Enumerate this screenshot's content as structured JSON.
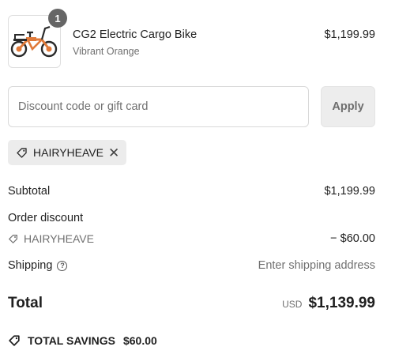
{
  "product": {
    "quantity": "1",
    "name": "CG2 Electric Cargo Bike",
    "variant": "Vibrant Orange",
    "price": "$1,199.99",
    "image_icon": "electric-cargo-bike"
  },
  "discount": {
    "placeholder": "Discount code or gift card",
    "value": "",
    "apply_label": "Apply",
    "applied_code": "HAIRYHEAVE"
  },
  "summary": {
    "subtotal_label": "Subtotal",
    "subtotal_value": "$1,199.99",
    "order_discount_label": "Order discount",
    "discount_code": "HAIRYHEAVE",
    "discount_value": "− $60.00",
    "shipping_label": "Shipping",
    "shipping_value": "Enter shipping address",
    "total_label": "Total",
    "currency": "USD",
    "total_value": "$1,139.99",
    "savings_label": "TOTAL SAVINGS",
    "savings_value": "$60.00"
  },
  "colors": {
    "bike_frame": "#e07a3a",
    "badge_bg": "#666666",
    "chip_bg": "#ececec",
    "button_bg": "#ededed"
  }
}
